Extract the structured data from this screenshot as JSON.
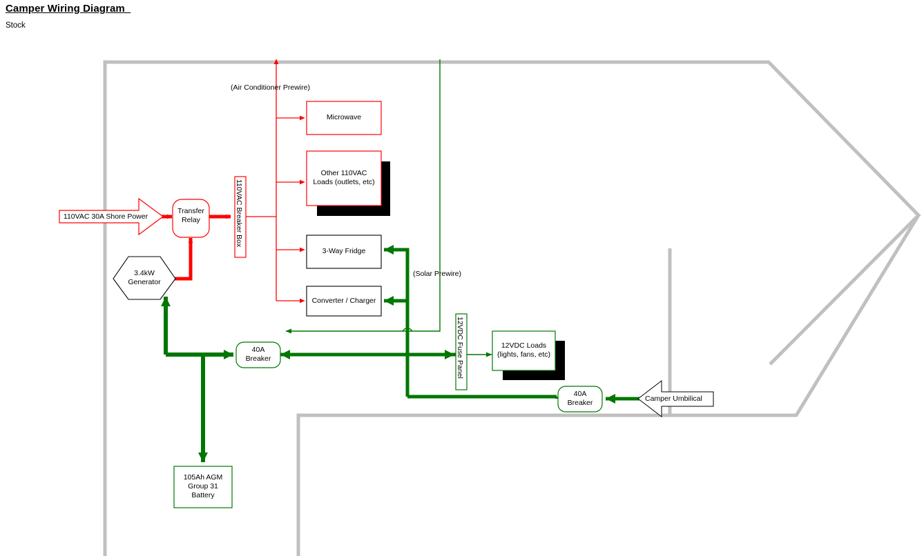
{
  "document": {
    "title": "Camper Wiring Diagram  ",
    "subtitle": "Stock"
  },
  "colors": {
    "ac_red": "#FF0000",
    "dc_green": "#007700",
    "body_gray": "#C0C0C0",
    "shadow_black": "#000000",
    "outline_black": "#000000",
    "background": "#FFFFFF"
  },
  "nodes": {
    "shore_power": {
      "label": "110VAC 30A Shore Power",
      "shape": "right-arrow",
      "stroke": "#FF0000"
    },
    "transfer_relay": {
      "label": "Transfer\nRelay",
      "shape": "rounded-rect",
      "stroke": "#FF0000"
    },
    "breaker_box": {
      "label": "110VAC Breaker Box",
      "shape": "vertical-rect",
      "stroke": "#FF0000"
    },
    "generator": {
      "label": "3.4kW\nGenerator",
      "shape": "hexagon",
      "stroke": "#000000"
    },
    "microwave": {
      "label": "Microwave",
      "shape": "rect",
      "stroke": "#FF0000"
    },
    "other_110vac_loads": {
      "label": "Other 110VAC\nLoads (outlets, etc)",
      "shape": "rect-shadow",
      "stroke": "#FF0000"
    },
    "three_way_fridge": {
      "label": "3-Way Fridge",
      "shape": "rect",
      "stroke": "#000000"
    },
    "converter_charger": {
      "label": "Converter / Charger",
      "shape": "rect",
      "stroke": "#000000"
    },
    "breaker_40a_left": {
      "label": "40A\nBreaker",
      "shape": "rounded-rect",
      "stroke": "#007700"
    },
    "fuse_panel": {
      "label": "12VDC Fuse Panel",
      "shape": "vertical-rect",
      "stroke": "#007700"
    },
    "twelve_vdc_loads": {
      "label": "12VDC Loads\n(lights, fans, etc)",
      "shape": "rect-shadow",
      "stroke": "#007700"
    },
    "breaker_40a_right": {
      "label": "40A\nBreaker",
      "shape": "rounded-rect",
      "stroke": "#007700"
    },
    "camper_umbilical": {
      "label": "Camper Umbilical",
      "shape": "left-arrow",
      "stroke": "#000000"
    },
    "battery": {
      "label": "105Ah AGM\nGroup 31\nBattery",
      "shape": "rect",
      "stroke": "#007700"
    }
  },
  "annotations": {
    "air_conditioner_prewire": "(Air Conditioner Prewire)",
    "solar_prewire": "(Solar Prewire)"
  }
}
